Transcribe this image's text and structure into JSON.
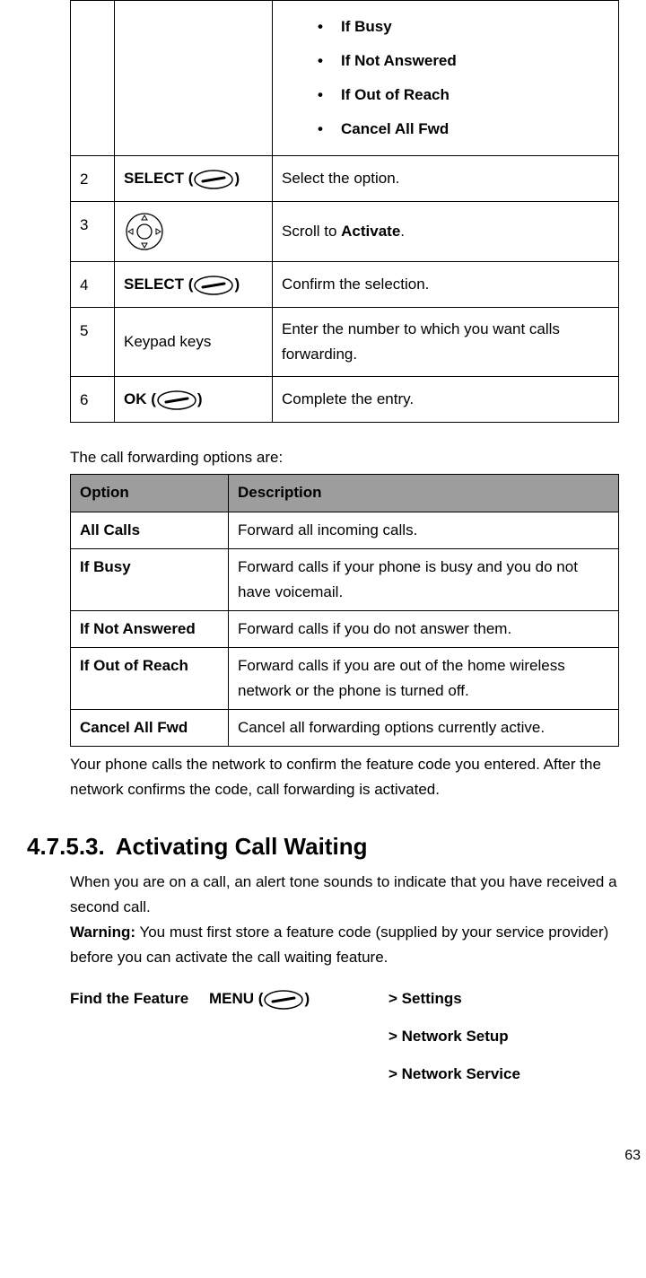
{
  "steps_top": {
    "bullets": [
      "If Busy",
      "If Not Answered",
      "If Out of Reach",
      "Cancel All Fwd"
    ],
    "rows": [
      {
        "num": "2",
        "press_pre": "SELECT (",
        "press_post": ")",
        "desc": "Select the option."
      },
      {
        "num": "3",
        "press": "",
        "desc_pre": "Scroll to ",
        "desc_bold": "Activate",
        "desc_post": "."
      },
      {
        "num": "4",
        "press_pre": "SELECT (",
        "press_post": ")",
        "desc": "Confirm the selection."
      },
      {
        "num": "5",
        "press_plain": "Keypad keys",
        "desc": "Enter the number to which you want calls forwarding."
      },
      {
        "num": "6",
        "press_pre": "OK (",
        "press_post": ")",
        "desc": "Complete the entry."
      }
    ]
  },
  "fwd_intro": "The call forwarding options are:",
  "opts_head": {
    "c1": "Option",
    "c2": "Description"
  },
  "opts": [
    {
      "name": "All Calls",
      "desc": "Forward all incoming calls."
    },
    {
      "name": "If Busy",
      "desc": "Forward calls if your phone is busy and you do not have voicemail."
    },
    {
      "name": "If Not Answered",
      "desc": "Forward calls if you do not answer them."
    },
    {
      "name": "If Out of Reach",
      "desc": "Forward calls if you are out of the home wireless network or the phone is turned off."
    },
    {
      "name": "Cancel All Fwd",
      "desc": "Cancel all forwarding options currently active."
    }
  ],
  "after_opts": "Your phone calls the network to confirm the feature code you entered. After the network confirms the code, call forwarding is activated.",
  "section": {
    "num": "4.7.5.3.",
    "title": "Activating Call Waiting"
  },
  "cw_para": "When you are on a call, an alert tone sounds to indicate that you have received a second call.",
  "warning_label": "Warning:",
  "warning_text": " You must first store a feature code (supplied by your service provider) before you can activate the call waiting feature.",
  "ftf": {
    "label": "Find the Feature",
    "menu_pre": "MENU (",
    "menu_post": ")",
    "path": [
      "> Settings",
      "> Network Setup",
      "> Network Service"
    ]
  },
  "page_number": "63"
}
